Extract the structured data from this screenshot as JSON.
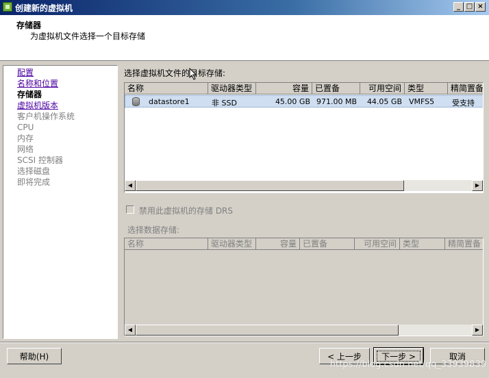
{
  "window": {
    "title": "创建新的虚拟机"
  },
  "header": {
    "title": "存储器",
    "subtitle": "为虚拟机文件选择一个目标存储"
  },
  "nav": {
    "items": [
      {
        "label": "配置",
        "state": "link"
      },
      {
        "label": "名称和位置",
        "state": "link"
      },
      {
        "label": "存储器",
        "state": "current"
      },
      {
        "label": "虚拟机版本",
        "state": "link"
      },
      {
        "label": "客户机操作系统",
        "state": "disabled"
      },
      {
        "label": "CPU",
        "state": "disabled"
      },
      {
        "label": "内存",
        "state": "disabled"
      },
      {
        "label": "网络",
        "state": "disabled"
      },
      {
        "label": "SCSI 控制器",
        "state": "disabled"
      },
      {
        "label": "选择磁盘",
        "state": "disabled"
      },
      {
        "label": "即将完成",
        "state": "disabled"
      }
    ]
  },
  "main": {
    "target_label": "选择虚拟机文件的目标存储:",
    "columns": [
      "名称",
      "驱动器类型",
      "容量",
      "已置备",
      "可用空间",
      "类型",
      "精简置备"
    ],
    "rows": [
      {
        "name": "datastore1",
        "drive_type": "非 SSD",
        "capacity": "45.00 GB",
        "provisioned": "971.00 MB",
        "free": "44.05 GB",
        "type": "VMFS5",
        "thin": "受支持"
      }
    ],
    "drs_label": "禁用此虚拟机的存储 DRS",
    "select_ds_label": "选择数据存储:",
    "columns2": [
      "名称",
      "驱动器类型",
      "容量",
      "已置备",
      "可用空间",
      "类型",
      "精简置备"
    ]
  },
  "footer": {
    "help": "帮助(H)",
    "back": "< 上一步",
    "next": "下一步 >",
    "cancel": "取消"
  },
  "watermark": "https://blog.csdn.net/qq_33939839"
}
